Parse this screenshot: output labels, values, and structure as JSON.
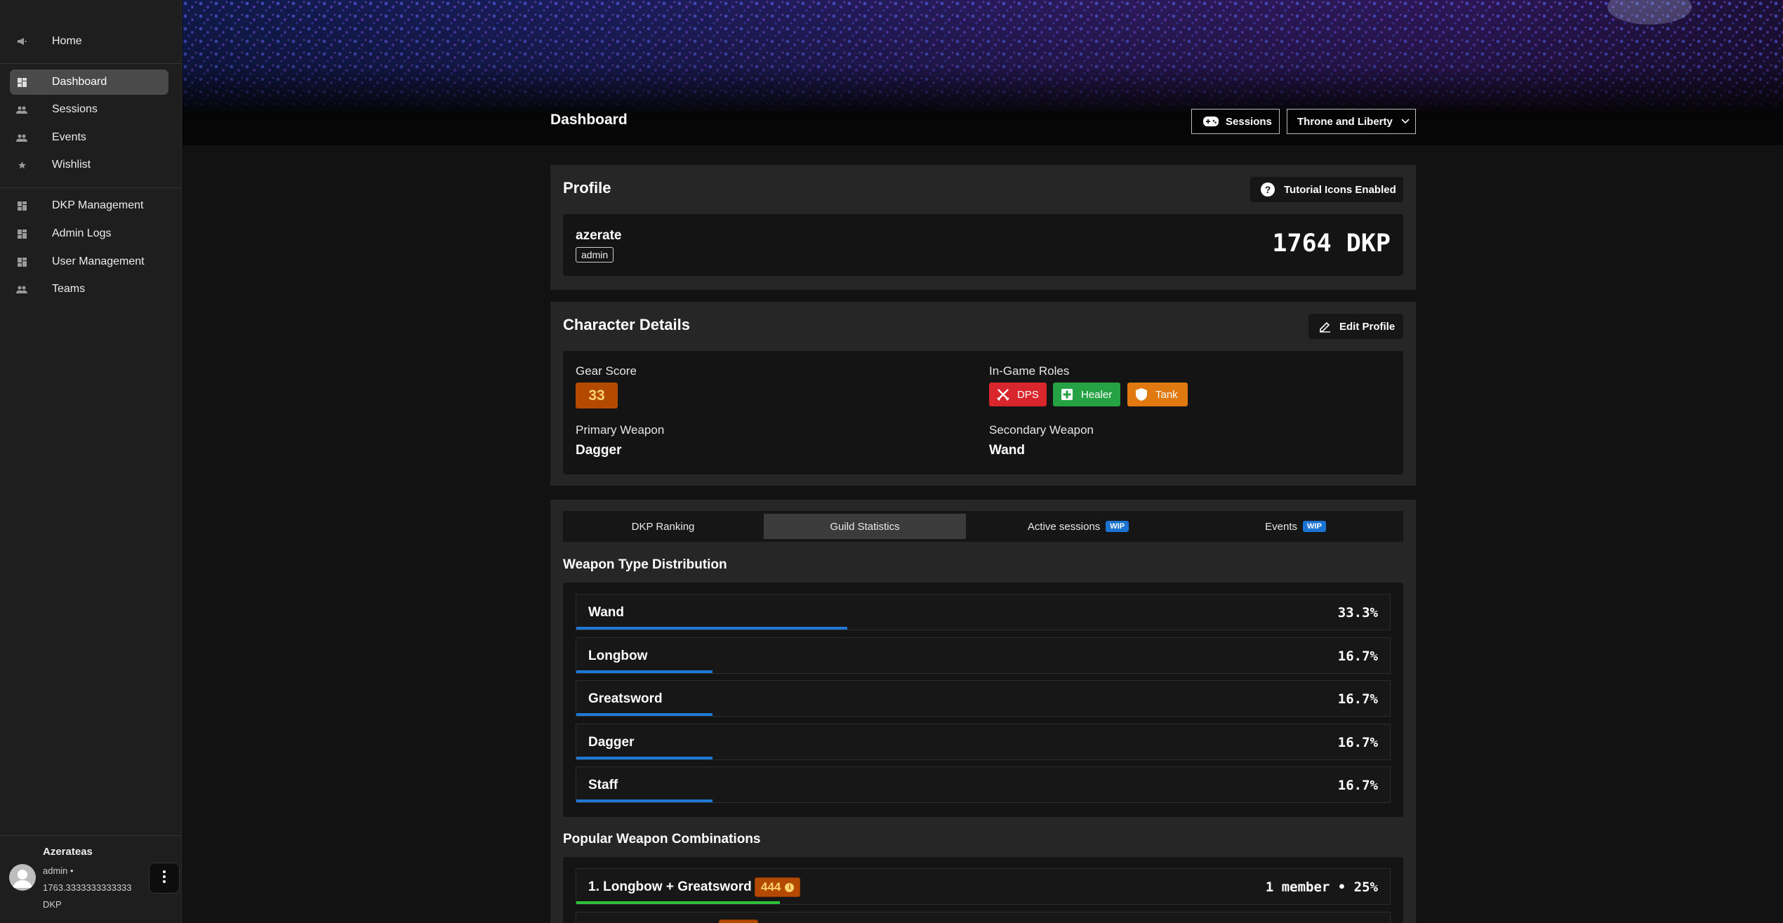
{
  "sidebar": {
    "items": [
      {
        "label": "Home",
        "icon": "megaphone-icon"
      },
      {
        "label": "Dashboard",
        "icon": "dashboard-icon"
      },
      {
        "label": "Sessions",
        "icon": "people-icon"
      },
      {
        "label": "Events",
        "icon": "people-icon"
      },
      {
        "label": "Wishlist",
        "icon": "star-icon"
      },
      {
        "label": "DKP Management",
        "icon": "dashboard-icon"
      },
      {
        "label": "Admin Logs",
        "icon": "dashboard-icon"
      },
      {
        "label": "User Management",
        "icon": "dashboard-icon"
      },
      {
        "label": "Teams",
        "icon": "people-icon"
      }
    ],
    "user": {
      "name": "Azerateas",
      "role_line": "admin •",
      "dkp_line": "1763.3333333333333",
      "dkp_unit": "DKP"
    }
  },
  "header": {
    "title": "Dashboard",
    "sessions_label": "Sessions",
    "game_select": "Throne and Liberty"
  },
  "profile": {
    "title": "Profile",
    "tutorial_label": "Tutorial Icons Enabled",
    "username": "azerate",
    "role_badge": "admin",
    "dkp": "1764 DKP"
  },
  "character": {
    "title": "Character Details",
    "edit_label": "Edit Profile",
    "gear_score_label": "Gear Score",
    "gear_score": "33",
    "roles_label": "In-Game Roles",
    "roles": [
      {
        "label": "DPS",
        "color": "#d9262c"
      },
      {
        "label": "Healer",
        "color": "#25a244"
      },
      {
        "label": "Tank",
        "color": "#e07a10"
      }
    ],
    "primary_label": "Primary Weapon",
    "primary": "Dagger",
    "secondary_label": "Secondary Weapon",
    "secondary": "Wand"
  },
  "tabs": [
    {
      "label": "DKP Ranking",
      "wip": ""
    },
    {
      "label": "Guild Statistics",
      "wip": ""
    },
    {
      "label": "Active sessions",
      "wip": "WIP"
    },
    {
      "label": "Events",
      "wip": "WIP"
    }
  ],
  "weapons": {
    "title": "Weapon Type Distribution",
    "rows": [
      {
        "name": "Wand",
        "pct": "33.3%",
        "value": 33.3
      },
      {
        "name": "Longbow",
        "pct": "16.7%",
        "value": 16.7
      },
      {
        "name": "Greatsword",
        "pct": "16.7%",
        "value": 16.7
      },
      {
        "name": "Dagger",
        "pct": "16.7%",
        "value": 16.7
      },
      {
        "name": "Staff",
        "pct": "16.7%",
        "value": 16.7
      }
    ]
  },
  "combos": {
    "title": "Popular Weapon Combinations",
    "rows": [
      {
        "name": "1. Longbow + Greatsword",
        "badge": "444",
        "meta": "1 member • 25%",
        "value": 25
      }
    ]
  },
  "colors": {
    "accent_blue": "#1e78d6",
    "combo_green": "#2ec23a",
    "gear_orange": "#b34a00"
  }
}
